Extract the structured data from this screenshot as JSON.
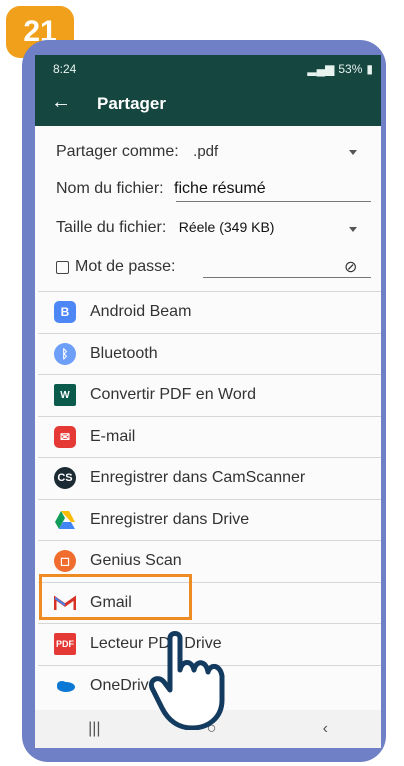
{
  "badge": {
    "number": "21"
  },
  "status": {
    "time": "8:24",
    "battery": "53%"
  },
  "toolbar": {
    "title": "Partager"
  },
  "form": {
    "share_as_label": "Partager comme:",
    "share_as_value": ".pdf",
    "filename_label": "Nom du fichier:",
    "filename_value": "fiche résumé",
    "filesize_label": "Taille du fichier:",
    "filesize_value": "Réele (349 KB)",
    "password_label": "Mot de passe:"
  },
  "share_targets": [
    {
      "label": "Android Beam",
      "icon": "android-beam-icon",
      "color": "#4d86f5"
    },
    {
      "label": "Bluetooth",
      "icon": "bluetooth-icon",
      "color": "#4d86f5"
    },
    {
      "label": "Convertir PDF en Word",
      "icon": "word-converter-icon",
      "color": "#0a5b4c"
    },
    {
      "label": "E-mail",
      "icon": "email-icon",
      "color": "#e53935"
    },
    {
      "label": "Enregistrer dans CamScanner",
      "icon": "camscanner-icon",
      "color": "#1c2a33"
    },
    {
      "label": "Enregistrer dans Drive",
      "icon": "google-drive-icon",
      "color": "#2f9d52"
    },
    {
      "label": "Genius Scan",
      "icon": "genius-scan-icon",
      "color": "#f06d2e"
    },
    {
      "label": "Gmail",
      "icon": "gmail-icon",
      "color": "#d93025"
    },
    {
      "label": "Lecteur PDF Drive",
      "icon": "pdf-reader-icon",
      "color": "#e53935"
    },
    {
      "label": "OneDrive",
      "icon": "onedrive-icon",
      "color": "#0a78d4"
    }
  ],
  "colors": {
    "appbar": "#15463f",
    "frame": "#6f80c6",
    "highlight": "#ee8b22",
    "badge": "#f0a01a"
  }
}
